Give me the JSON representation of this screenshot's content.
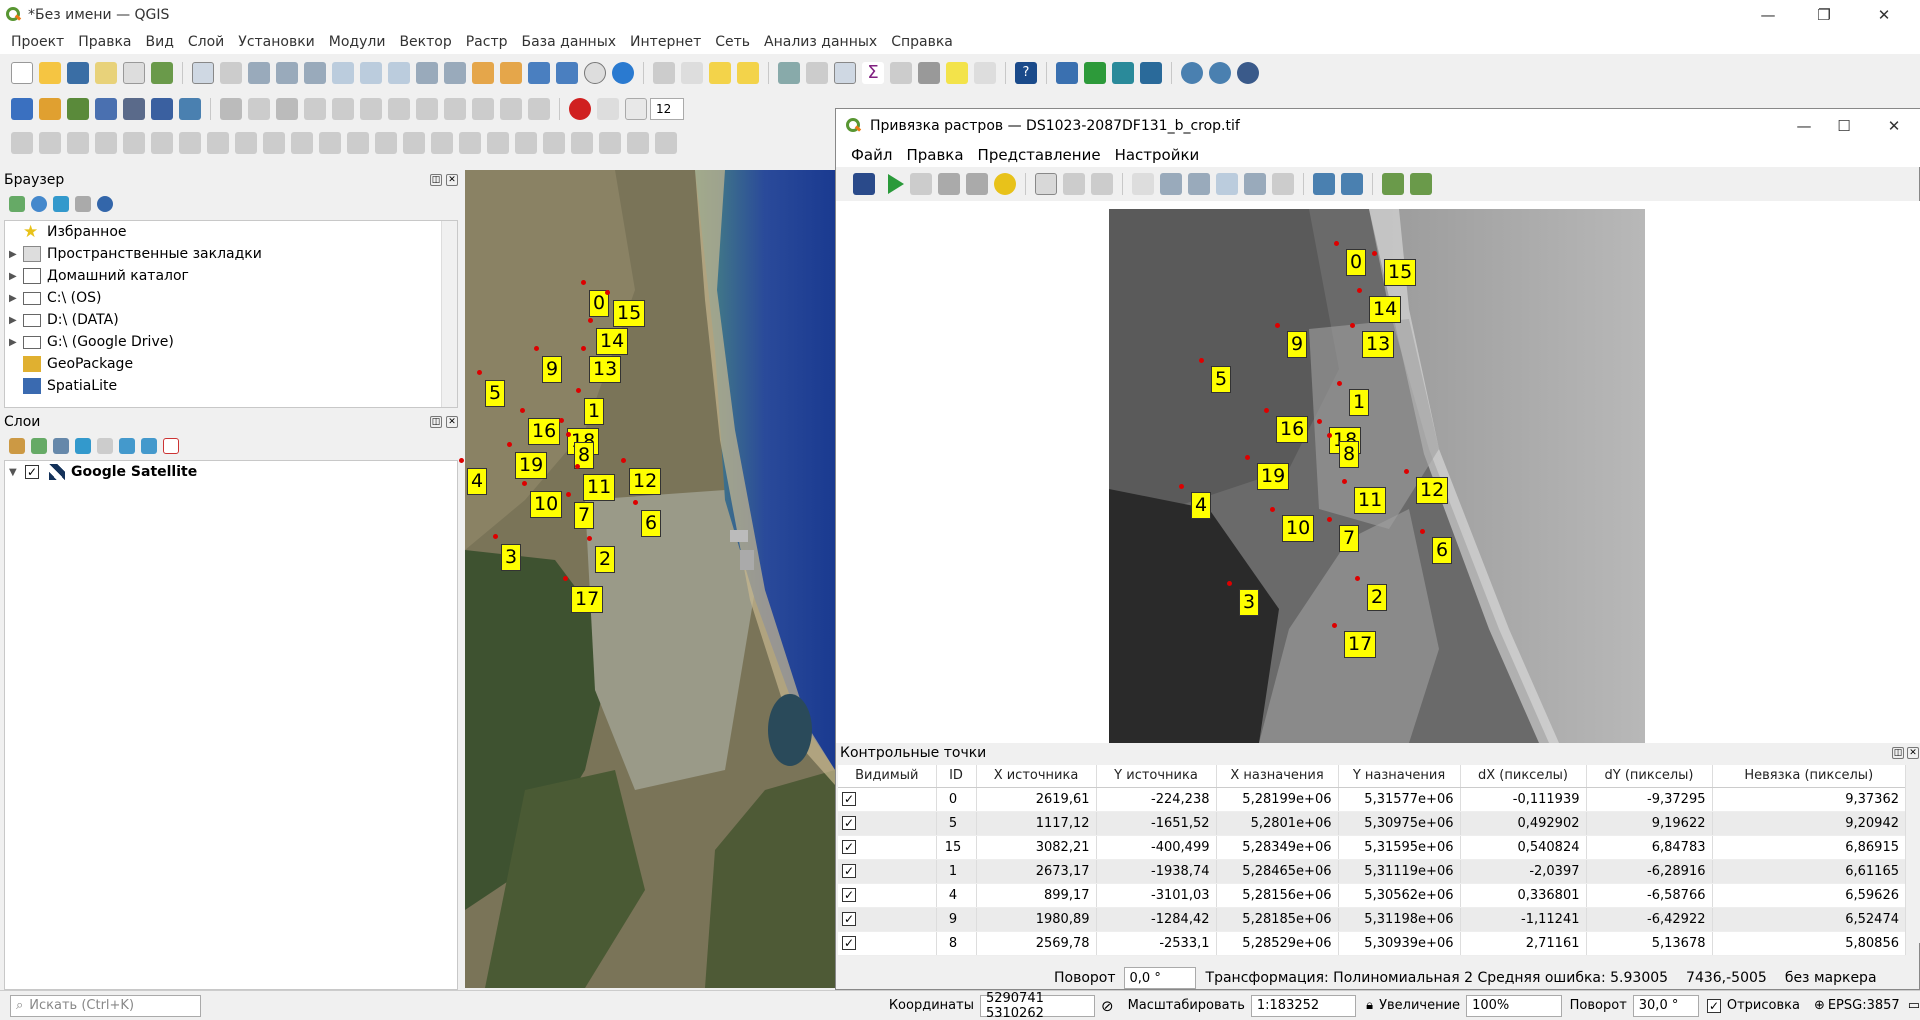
{
  "window": {
    "title": "*Без имени — QGIS"
  },
  "menu": [
    "Проект",
    "Правка",
    "Вид",
    "Слой",
    "Установки",
    "Модули",
    "Вектор",
    "Растр",
    "База данных",
    "Интернет",
    "Сеть",
    "Анализ данных",
    "Справка"
  ],
  "browser": {
    "title": "Браузер",
    "items": [
      "Избранное",
      "Пространственные закладки",
      "Домашний каталог",
      "C:\\ (OS)",
      "D:\\ (DATA)",
      "G:\\ (Google Drive)",
      "GeoPackage",
      "SpatiaLite"
    ]
  },
  "layers": {
    "title": "Слои",
    "items": [
      "Google Satellite"
    ]
  },
  "toolbar": {
    "zoom_value": "12"
  },
  "map_gcps": [
    "0",
    "15",
    "14",
    "9",
    "13",
    "5",
    "1",
    "16",
    "18",
    "8",
    "19",
    "11",
    "12",
    "4",
    "10",
    "7",
    "6",
    "3",
    "2",
    "17"
  ],
  "georef": {
    "title": "Привязка растров — DS1023-2087DF131_b_crop.tif",
    "menu": [
      "Файл",
      "Правка",
      "Представление",
      "Настройки"
    ],
    "image_gcps": [
      "0",
      "15",
      "14",
      "9",
      "13",
      "5",
      "1",
      "16",
      "18",
      "8",
      "19",
      "11",
      "12",
      "4",
      "10",
      "7",
      "6",
      "3",
      "2",
      "17"
    ],
    "gcp_panel_title": "Контрольные точки",
    "columns": [
      "Видимый",
      "ID",
      "X источника",
      "Y источника",
      "X назначения",
      "Y назначения",
      "dX (пикселы)",
      "dY (пикселы)",
      "Невязка (пикселы)"
    ],
    "rows": [
      [
        "0",
        "2619,61",
        "-224,238",
        "5,28199e+06",
        "5,31577e+06",
        "-0,111939",
        "-9,37295",
        "9,37362"
      ],
      [
        "5",
        "1117,12",
        "-1651,52",
        "5,2801e+06",
        "5,30975e+06",
        "0,492902",
        "9,19622",
        "9,20942"
      ],
      [
        "15",
        "3082,21",
        "-400,499",
        "5,28349e+06",
        "5,31595e+06",
        "0,540824",
        "6,84783",
        "6,86915"
      ],
      [
        "1",
        "2673,17",
        "-1938,74",
        "5,28465e+06",
        "5,31119e+06",
        "-2,0397",
        "-6,28916",
        "6,61165"
      ],
      [
        "4",
        "899,17",
        "-3101,03",
        "5,28156e+06",
        "5,30562e+06",
        "0,336801",
        "-6,58766",
        "6,59626"
      ],
      [
        "9",
        "1980,89",
        "-1284,42",
        "5,28185e+06",
        "5,31198e+06",
        "-1,11241",
        "-6,42922",
        "6,52474"
      ],
      [
        "8",
        "2569,78",
        "-2533,1",
        "5,28529e+06",
        "5,30939e+06",
        "2,71161",
        "5,13678",
        "5,80856"
      ]
    ],
    "status": {
      "rotation_label": "Поворот",
      "rotation_value": "0,0 °",
      "transform": "Трансформация: Полиномиальная 2 Средняя ошибка: 5.93005",
      "coords": "7436,-5005",
      "marker": "без маркера"
    }
  },
  "status": {
    "search_placeholder": "Искать (Ctrl+K)",
    "coords_label": "Координаты",
    "coords_value": "5290741 5310262",
    "scale_label": "Масштабировать",
    "scale_value": "1:183252",
    "magnifier_label": "Увеличение",
    "magnifier_value": "100%",
    "rotation_label": "Поворот",
    "rotation_value": "30,0 °",
    "render_label": "Отрисовка",
    "crs": "EPSG:3857"
  },
  "colors": {
    "gcp_label": "#ffff00",
    "gcp_dot": "#d00000",
    "accent": "#2e7d32"
  }
}
